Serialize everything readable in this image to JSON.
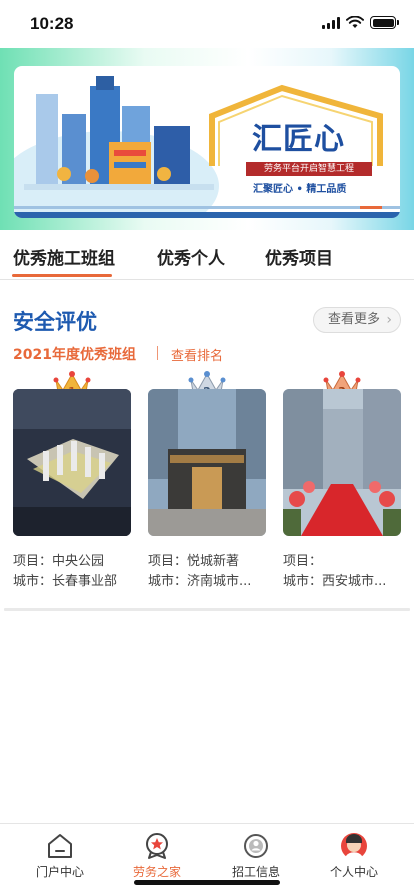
{
  "status_bar": {
    "time": "10:28"
  },
  "banner": {
    "title": "汇匠心",
    "subtitle": "劳务平台开启智慧工程",
    "slogan": "汇聚匠心 • 精工品质"
  },
  "tabs": [
    {
      "label": "优秀施工班组",
      "active": true
    },
    {
      "label": "优秀个人",
      "active": false
    },
    {
      "label": "优秀项目",
      "active": false
    }
  ],
  "section": {
    "title": "安全评优",
    "more_label": "查看更多",
    "subtitle": "2021年度优秀班组",
    "rank_link": "查看排名"
  },
  "cards": [
    {
      "rank_icon": "crown-1-icon",
      "project_line": "项目：中央公园",
      "city_line": "城市：长春事业部"
    },
    {
      "rank_icon": "crown-2-icon",
      "project_line": "项目：悦城新著",
      "city_line": "城市：济南城市..."
    },
    {
      "rank_icon": "crown-3-icon",
      "project_line": "项目：",
      "city_line": "城市：西安城市..."
    }
  ],
  "bottom_nav": [
    {
      "label": "门户中心",
      "icon": "home-icon",
      "active": false
    },
    {
      "label": "劳务之家",
      "icon": "star-badge-icon",
      "active": true
    },
    {
      "label": "招工信息",
      "icon": "recruit-icon",
      "active": false
    },
    {
      "label": "个人中心",
      "icon": "avatar-icon",
      "active": false
    }
  ],
  "colors": {
    "accent": "#e8693a",
    "title_blue": "#1e5ab0"
  }
}
